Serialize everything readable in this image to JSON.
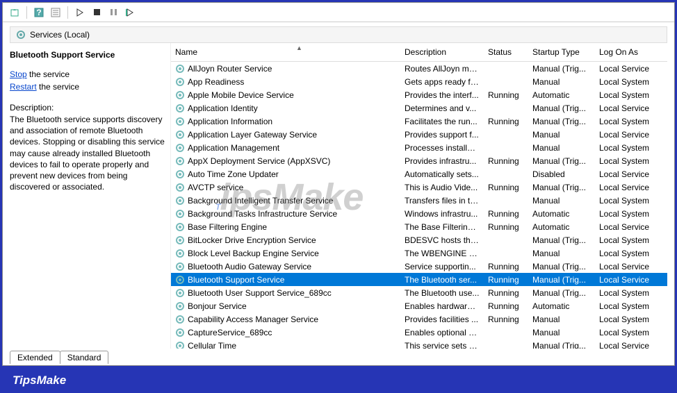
{
  "view_header": "Services (Local)",
  "detail": {
    "title": "Bluetooth Support Service",
    "stop_link": "Stop",
    "stop_suffix": " the service",
    "restart_link": "Restart",
    "restart_suffix": " the service",
    "desc_label": "Description:",
    "desc_body": "The Bluetooth service supports discovery and association of remote Bluetooth devices.  Stopping or disabling this service may cause already installed Bluetooth devices to fail to operate properly and prevent new devices from being discovered or associated."
  },
  "columns": {
    "name": "Name",
    "desc": "Description",
    "status": "Status",
    "startup": "Startup Type",
    "logon": "Log On As"
  },
  "tabs": {
    "extended": "Extended",
    "standard": "Standard"
  },
  "footer_brand": "TipsMake",
  "services": [
    {
      "name": "AllJoyn Router Service",
      "desc": "Routes AllJoyn me...",
      "status": "",
      "startup": "Manual (Trig...",
      "logon": "Local Service",
      "sel": false
    },
    {
      "name": "App Readiness",
      "desc": "Gets apps ready fo...",
      "status": "",
      "startup": "Manual",
      "logon": "Local System",
      "sel": false
    },
    {
      "name": "Apple Mobile Device Service",
      "desc": "Provides the interf...",
      "status": "Running",
      "startup": "Automatic",
      "logon": "Local System",
      "sel": false
    },
    {
      "name": "Application Identity",
      "desc": "Determines and v...",
      "status": "",
      "startup": "Manual (Trig...",
      "logon": "Local Service",
      "sel": false
    },
    {
      "name": "Application Information",
      "desc": "Facilitates the run...",
      "status": "Running",
      "startup": "Manual (Trig...",
      "logon": "Local System",
      "sel": false
    },
    {
      "name": "Application Layer Gateway Service",
      "desc": "Provides support f...",
      "status": "",
      "startup": "Manual",
      "logon": "Local Service",
      "sel": false
    },
    {
      "name": "Application Management",
      "desc": "Processes installat...",
      "status": "",
      "startup": "Manual",
      "logon": "Local System",
      "sel": false
    },
    {
      "name": "AppX Deployment Service (AppXSVC)",
      "desc": "Provides infrastru...",
      "status": "Running",
      "startup": "Manual (Trig...",
      "logon": "Local System",
      "sel": false
    },
    {
      "name": "Auto Time Zone Updater",
      "desc": "Automatically sets...",
      "status": "",
      "startup": "Disabled",
      "logon": "Local Service",
      "sel": false
    },
    {
      "name": "AVCTP service",
      "desc": "This is Audio Vide...",
      "status": "Running",
      "startup": "Manual (Trig...",
      "logon": "Local Service",
      "sel": false
    },
    {
      "name": "Background Intelligent Transfer Service",
      "desc": "Transfers files in th...",
      "status": "",
      "startup": "Manual",
      "logon": "Local System",
      "sel": false
    },
    {
      "name": "Background Tasks Infrastructure Service",
      "desc": "Windows infrastru...",
      "status": "Running",
      "startup": "Automatic",
      "logon": "Local System",
      "sel": false
    },
    {
      "name": "Base Filtering Engine",
      "desc": "The Base Filtering ...",
      "status": "Running",
      "startup": "Automatic",
      "logon": "Local Service",
      "sel": false
    },
    {
      "name": "BitLocker Drive Encryption Service",
      "desc": "BDESVC hosts the ...",
      "status": "",
      "startup": "Manual (Trig...",
      "logon": "Local System",
      "sel": false
    },
    {
      "name": "Block Level Backup Engine Service",
      "desc": "The WBENGINE se...",
      "status": "",
      "startup": "Manual",
      "logon": "Local System",
      "sel": false
    },
    {
      "name": "Bluetooth Audio Gateway Service",
      "desc": "Service supportin...",
      "status": "Running",
      "startup": "Manual (Trig...",
      "logon": "Local Service",
      "sel": false
    },
    {
      "name": "Bluetooth Support Service",
      "desc": "The Bluetooth ser...",
      "status": "Running",
      "startup": "Manual (Trig...",
      "logon": "Local Service",
      "sel": true
    },
    {
      "name": "Bluetooth User Support Service_689cc",
      "desc": "The Bluetooth use...",
      "status": "Running",
      "startup": "Manual (Trig...",
      "logon": "Local System",
      "sel": false
    },
    {
      "name": "Bonjour Service",
      "desc": "Enables hardware ...",
      "status": "Running",
      "startup": "Automatic",
      "logon": "Local System",
      "sel": false
    },
    {
      "name": "Capability Access Manager Service",
      "desc": "Provides facilities ...",
      "status": "Running",
      "startup": "Manual",
      "logon": "Local System",
      "sel": false
    },
    {
      "name": "CaptureService_689cc",
      "desc": "Enables optional s...",
      "status": "",
      "startup": "Manual",
      "logon": "Local System",
      "sel": false
    },
    {
      "name": "Cellular Time",
      "desc": "This service sets ti...",
      "status": "",
      "startup": "Manual (Trig...",
      "logon": "Local Service",
      "sel": false
    }
  ]
}
